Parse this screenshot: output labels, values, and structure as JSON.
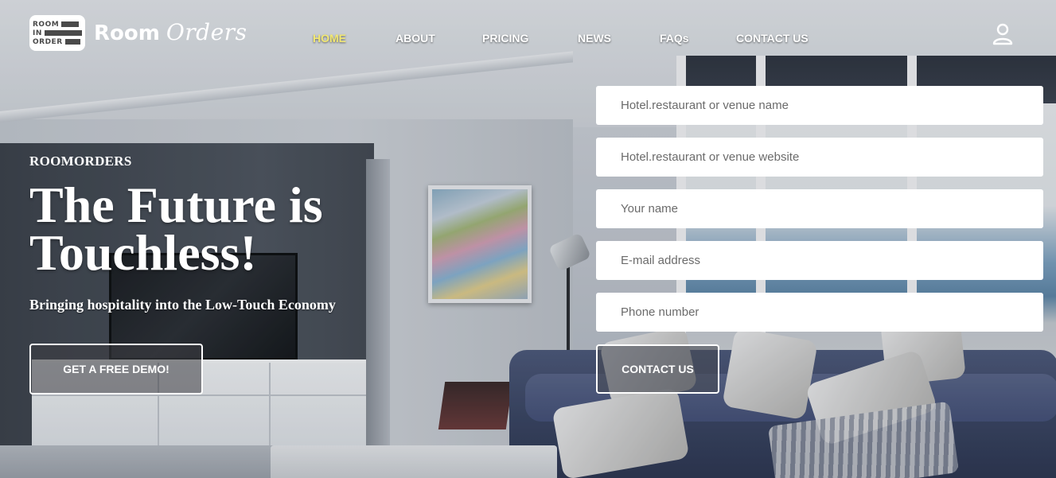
{
  "brand": {
    "logo_words": [
      "ROOM",
      "IN",
      "ORDER"
    ],
    "name_part1": "Room",
    "name_part2": "Orders"
  },
  "nav": {
    "items": [
      {
        "label": "HOME",
        "active": true
      },
      {
        "label": "ABOUT",
        "active": false
      },
      {
        "label": "PRICING",
        "active": false
      },
      {
        "label": "NEWS",
        "active": false
      },
      {
        "label": "FAQs",
        "active": false
      },
      {
        "label": "CONTACT US",
        "active": false
      }
    ],
    "active_color": "#f2e873",
    "account_icon": "user-icon"
  },
  "hero": {
    "eyebrow": "ROOMORDERS",
    "headline": "The Future is Touchless!",
    "subheadline": "Bringing hospitality into the Low-Touch Economy",
    "cta_label": "GET A FREE DEMO!"
  },
  "form": {
    "fields": [
      {
        "placeholder": "Hotel.restaurant or venue name",
        "value": ""
      },
      {
        "placeholder": "Hotel.restaurant or venue website",
        "value": ""
      },
      {
        "placeholder": "Your name",
        "value": ""
      },
      {
        "placeholder": "E-mail address",
        "value": ""
      },
      {
        "placeholder": "Phone number",
        "value": ""
      }
    ],
    "submit_label": "CONTACT US"
  }
}
